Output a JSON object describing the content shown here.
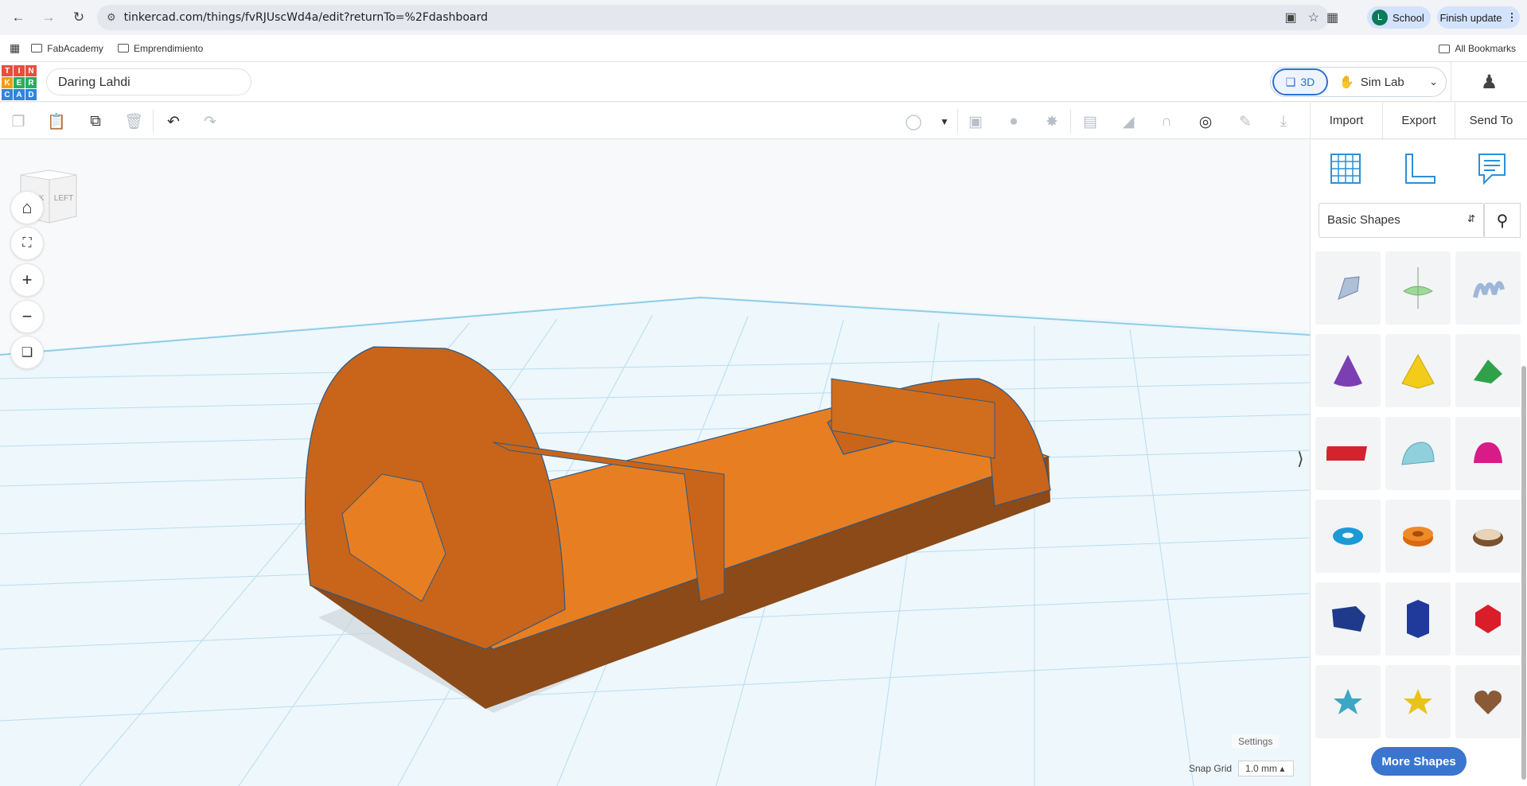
{
  "browser": {
    "url": "tinkercad.com/things/fvRJUscWd4a/edit?returnTo=%2Fdashboard",
    "profile_initial": "L",
    "profile_label": "School",
    "update_label": "Finish update",
    "bookmarks": [
      {
        "label": "FabAcademy"
      },
      {
        "label": "Emprendimiento"
      }
    ],
    "all_bookmarks": "All Bookmarks"
  },
  "logo": [
    "T",
    "I",
    "N",
    "K",
    "E",
    "R",
    "C",
    "A",
    "D"
  ],
  "header": {
    "design_name": "Daring Lahdi",
    "view_3d": "3D",
    "view_sim": "Sim Lab"
  },
  "actions": {
    "import": "Import",
    "export": "Export",
    "send_to": "Send To"
  },
  "viewcube": {
    "back": "BACK",
    "left": "LEFT"
  },
  "panel": {
    "category": "Basic Shapes",
    "more_shapes": "More Shapes"
  },
  "footer": {
    "settings": "Settings",
    "snap_label": "Snap Grid",
    "snap_value": "1.0 mm"
  },
  "colors": {
    "accent": "#2f6fd6",
    "model_orange": "#e87e22",
    "grid": "#9fd6ec"
  }
}
